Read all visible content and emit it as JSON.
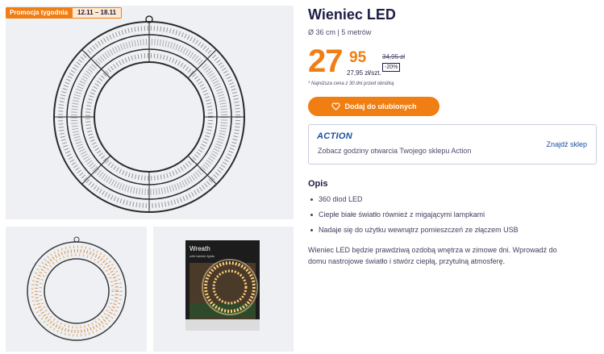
{
  "promo": {
    "label": "Promocja tygodnia",
    "dates": "12.11 – 18.11"
  },
  "product": {
    "title": "Wieniec LED",
    "subtitle": "Ø 36 cm | 5 metrów"
  },
  "price": {
    "whole": "27",
    "cents": "95",
    "old": "34,95 zł",
    "discount": "-20%",
    "unit": "27,95 zł/szt.",
    "lowest_note": "* Najniższa cena z 30 dni przed obniżką"
  },
  "actions": {
    "favorite_label": "Dodaj do ulubionych"
  },
  "store": {
    "logo": "ACTION",
    "hours_text": "Zobacz godziny otwarcia Twojego sklepu Action",
    "find_link": "Znajdź sklep"
  },
  "description": {
    "heading": "Opis",
    "bullets": [
      "360 diod LED",
      "Ciepłe białe światło również z migającymi lampkami",
      "Nadaje się do użytku wewnątrz pomieszczeń ze złączem USB"
    ],
    "text": "Wieniec LED będzie prawdziwą ozdobą wnętrza w zimowe dni. Wprowadź do domu nastrojowe światło i stwórz ciepłą, przytulną atmosferę."
  },
  "packaging": {
    "brand": "Wreath",
    "sub": "with twinkle lights"
  },
  "colors": {
    "accent": "#f07e12",
    "navy": "#1e1e46",
    "link": "#1a4fa3",
    "image_bg": "#eef0f3"
  }
}
